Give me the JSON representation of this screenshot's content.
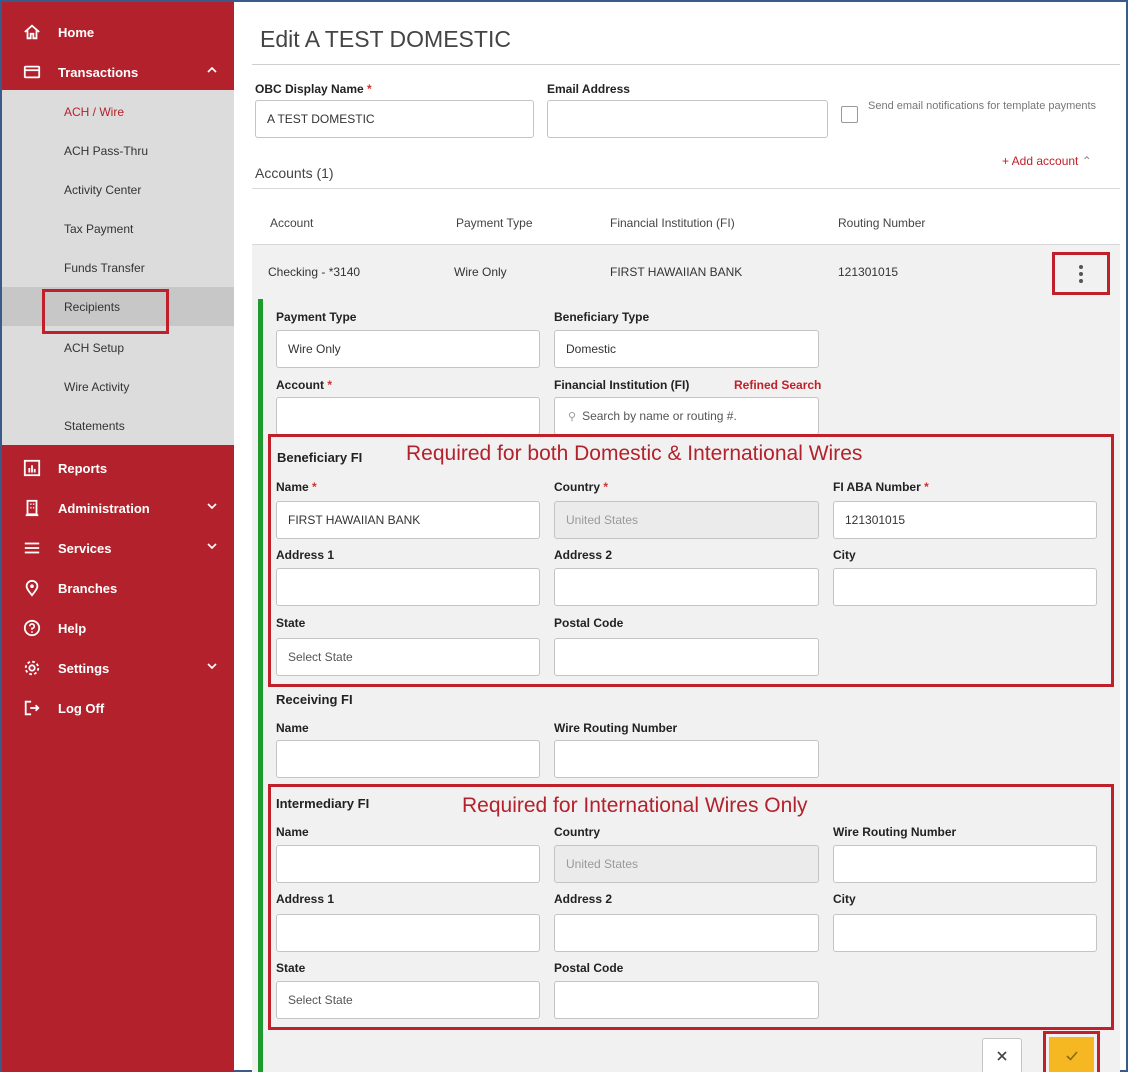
{
  "sidebar": {
    "nav_top": [
      {
        "label": "Home",
        "icon": "home-icon"
      },
      {
        "label": "Transactions",
        "icon": "card-icon"
      }
    ],
    "transactions_items": [
      {
        "label": "ACH / Wire"
      },
      {
        "label": "ACH Pass-Thru"
      },
      {
        "label": "Activity Center"
      },
      {
        "label": "Tax Payment"
      },
      {
        "label": "Funds Transfer"
      },
      {
        "label": "Recipients"
      },
      {
        "label": "ACH Setup"
      },
      {
        "label": "Wire Activity"
      },
      {
        "label": "Statements"
      }
    ],
    "nav_bottom": [
      {
        "label": "Reports",
        "icon": "chart-icon"
      },
      {
        "label": "Administration",
        "icon": "building-icon"
      },
      {
        "label": "Services",
        "icon": "menu-icon"
      },
      {
        "label": "Branches",
        "icon": "location-pin-icon"
      },
      {
        "label": "Help",
        "icon": "help-icon"
      },
      {
        "label": "Settings",
        "icon": "gear-icon"
      },
      {
        "label": "Log Off",
        "icon": "logout-icon"
      }
    ]
  },
  "page": {
    "title": "Edit A TEST DOMESTIC",
    "display_name_label": "OBC Display Name",
    "display_name_value": "A TEST DOMESTIC",
    "email_label": "Email Address",
    "email_value": "",
    "notify_label": "Send email notifications for template payments",
    "required_mark": "*"
  },
  "accounts": {
    "title": "Accounts (1)",
    "add_label": "+ Add account",
    "headers": [
      "Account",
      "Payment Type",
      "Financial Institution (FI)",
      "Routing Number"
    ],
    "row": {
      "account": "Checking - *3140",
      "payment_type": "Wire Only",
      "fi": "FIRST HAWAIIAN BANK",
      "routing": "121301015"
    }
  },
  "detail": {
    "payment_type_label": "Payment Type",
    "payment_type_value": "Wire Only",
    "beneficiary_type_label": "Beneficiary Type",
    "beneficiary_type_value": "Domestic",
    "account_label": "Account",
    "account_value": "",
    "fi_label": "Financial Institution (FI)",
    "refined_search": "Refined Search",
    "fi_placeholder": "Search by name or routing #."
  },
  "beneficiary_fi": {
    "title": "Beneficiary FI",
    "note": "Required for both Domestic & International Wires",
    "name_label": "Name",
    "name_value": "FIRST HAWAIIAN BANK",
    "country_label": "Country",
    "country_value": "United States",
    "aba_label": "FI ABA Number",
    "aba_value": "121301015",
    "address1_label": "Address 1",
    "address2_label": "Address 2",
    "city_label": "City",
    "state_label": "State",
    "state_value": "Select State",
    "postal_label": "Postal Code"
  },
  "receiving_fi": {
    "title": "Receiving FI",
    "name_label": "Name",
    "routing_label": "Wire Routing Number"
  },
  "intermediary_fi": {
    "title": "Intermediary FI",
    "note": "Required for International Wires Only",
    "name_label": "Name",
    "country_label": "Country",
    "country_value": "United States",
    "routing_label": "Wire Routing Number",
    "address1_label": "Address 1",
    "address2_label": "Address 2",
    "city_label": "City",
    "state_label": "State",
    "state_value": "Select State",
    "postal_label": "Postal Code"
  },
  "actions": {
    "cancel_icon": "close-icon",
    "save_icon": "check-icon"
  },
  "colors": {
    "brand_red": "#b3222c",
    "submenu_gray": "#dcdcdc",
    "panel_gray": "#f1f1f1",
    "accent_green": "#1e9a2e",
    "save_yellow": "#f5b823",
    "annotation_red": "#c0202a"
  }
}
